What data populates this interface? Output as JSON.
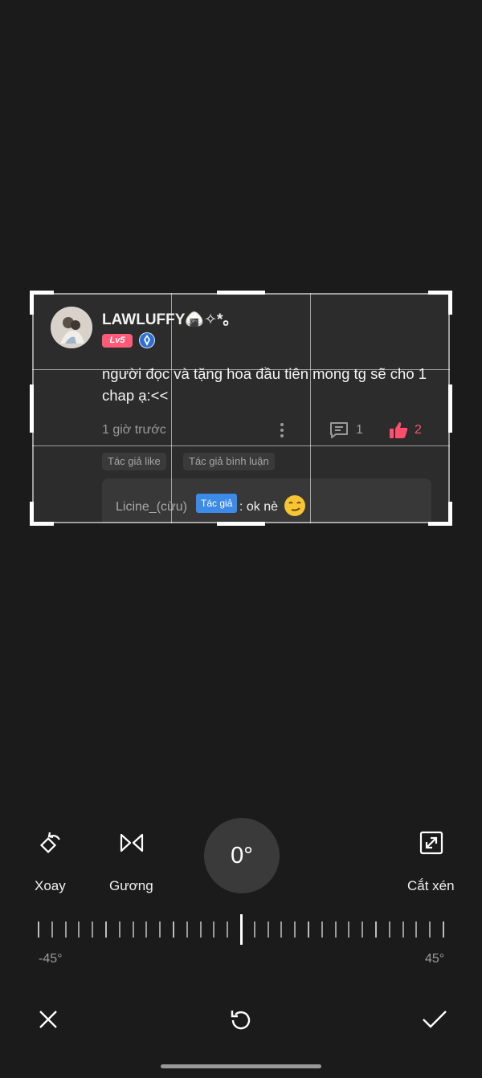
{
  "comment": {
    "username": "LAWLUFFY🍙✧*。",
    "level": "Lv5",
    "text": "người đọc và tặng hoa đầu tiên mong tg sẽ cho 1 chap ạ:<<",
    "time": "1 giờ trước",
    "reply_count": "1",
    "like_count": "2",
    "tags": [
      "Tác giả like",
      "Tác giả bình luận"
    ],
    "reply": {
      "user": "Licine_(cừu)",
      "badge": "Tác giả",
      "text": ": ok nè"
    }
  },
  "tools": {
    "rotate_label": "Xoay",
    "mirror_label": "Gương",
    "crop_label": "Cắt xén",
    "angle": "0°",
    "min_label": "-45°",
    "max_label": "45°",
    "angle_value_deg": 0
  },
  "colors": {
    "background": "#1b1b1b",
    "level_badge": "#ff5a78",
    "author_badge": "#3d8be8",
    "like": "#ff4f6d"
  }
}
